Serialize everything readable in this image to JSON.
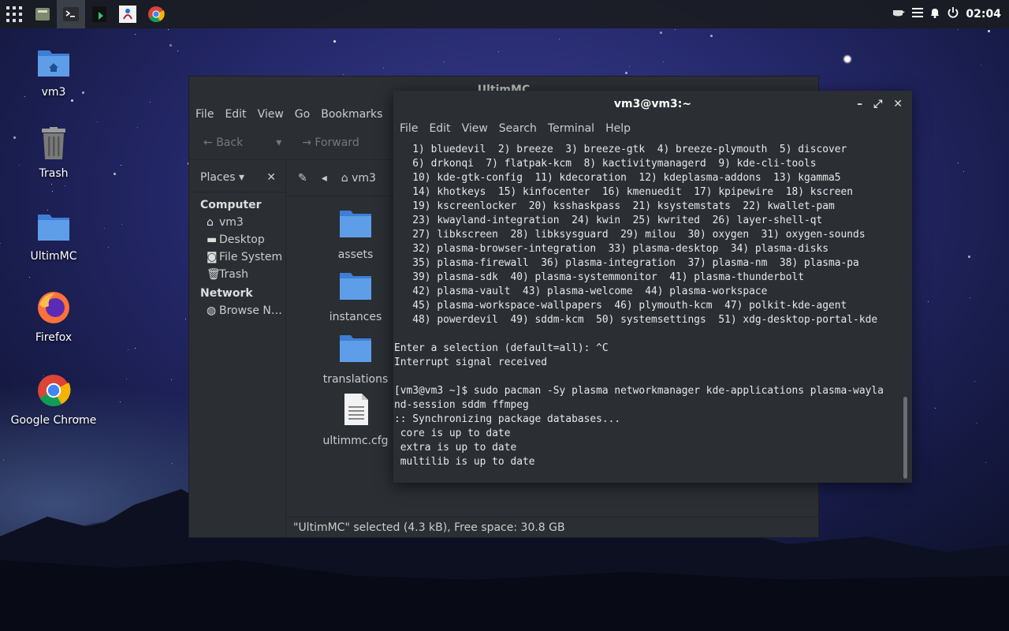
{
  "panel": {
    "apps": [
      {
        "name": "app-launcher-icon"
      },
      {
        "name": "file-manager-icon"
      },
      {
        "name": "terminal-icon"
      },
      {
        "name": "system-monitor-icon"
      },
      {
        "name": "java-icon"
      },
      {
        "name": "chrome-icon"
      }
    ],
    "clock": "02:04"
  },
  "desktop": {
    "icons": [
      {
        "label": "vm3"
      },
      {
        "label": "Trash"
      },
      {
        "label": "UltimMC"
      },
      {
        "label": "Firefox"
      },
      {
        "label": "Google Chrome"
      }
    ]
  },
  "file_manager": {
    "title": "UltimMC",
    "menu": [
      "File",
      "Edit",
      "View",
      "Go",
      "Bookmarks"
    ],
    "back_label": "Back",
    "forward_label": "Forward",
    "places_label": "Places",
    "path_label": "vm3",
    "sidebar": {
      "computer_heading": "Computer",
      "computer_items": [
        {
          "label": "vm3",
          "glyph": "⌂"
        },
        {
          "label": "Desktop",
          "glyph": "▬"
        },
        {
          "label": "File System",
          "glyph": "◙"
        },
        {
          "label": "Trash",
          "glyph": "🗑"
        }
      ],
      "network_heading": "Network",
      "network_items": [
        {
          "label": "Browse N…",
          "glyph": "◍"
        }
      ]
    },
    "files": [
      {
        "label": "assets",
        "kind": "folder"
      },
      {
        "label": "instances",
        "kind": "folder"
      },
      {
        "label": "translations",
        "kind": "folder"
      },
      {
        "label": "ultimmc.cfg",
        "kind": "file"
      }
    ],
    "status": "\"UltimMC\" selected (4.3 kB), Free space: 30.8 GB"
  },
  "terminal": {
    "title": "vm3@vm3:~",
    "menu": [
      "File",
      "Edit",
      "View",
      "Search",
      "Terminal",
      "Help"
    ],
    "lines": [
      "   1) bluedevil  2) breeze  3) breeze-gtk  4) breeze-plymouth  5) discover",
      "   6) drkonqi  7) flatpak-kcm  8) kactivitymanagerd  9) kde-cli-tools",
      "   10) kde-gtk-config  11) kdecoration  12) kdeplasma-addons  13) kgamma5",
      "   14) khotkeys  15) kinfocenter  16) kmenuedit  17) kpipewire  18) kscreen",
      "   19) kscreenlocker  20) ksshaskpass  21) ksystemstats  22) kwallet-pam",
      "   23) kwayland-integration  24) kwin  25) kwrited  26) layer-shell-qt",
      "   27) libkscreen  28) libksysguard  29) milou  30) oxygen  31) oxygen-sounds",
      "   32) plasma-browser-integration  33) plasma-desktop  34) plasma-disks",
      "   35) plasma-firewall  36) plasma-integration  37) plasma-nm  38) plasma-pa",
      "   39) plasma-sdk  40) plasma-systemmonitor  41) plasma-thunderbolt",
      "   42) plasma-vault  43) plasma-welcome  44) plasma-workspace",
      "   45) plasma-workspace-wallpapers  46) plymouth-kcm  47) polkit-kde-agent",
      "   48) powerdevil  49) sddm-kcm  50) systemsettings  51) xdg-desktop-portal-kde",
      "",
      "Enter a selection (default=all): ^C",
      "Interrupt signal received",
      "",
      "[vm3@vm3 ~]$ sudo pacman -Sy plasma networkmanager kde-applications plasma-wayla",
      "nd-session sddm ffmpeg",
      ":: Synchronizing package databases...",
      " core is up to date",
      " extra is up to date",
      " multilib is up to date"
    ]
  }
}
